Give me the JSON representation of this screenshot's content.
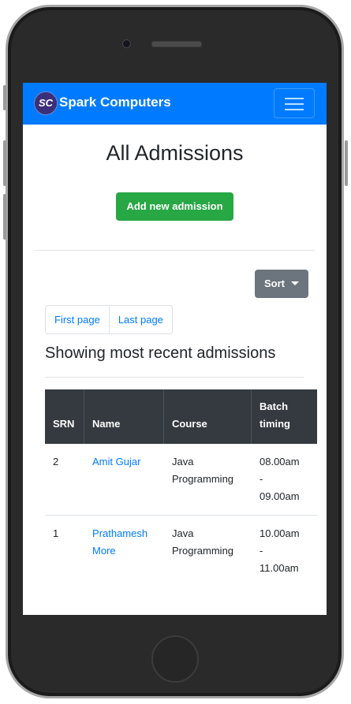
{
  "navbar": {
    "brand_logo_text": "SC",
    "brand_name": "Spark Computers"
  },
  "page": {
    "title": "All Admissions",
    "add_button": "Add new admission",
    "sort_button": "Sort",
    "pagination": {
      "first": "First page",
      "last": "Last page"
    },
    "subtitle": "Showing most recent admissions"
  },
  "table": {
    "headers": {
      "srn": "SRN",
      "name": "Name",
      "course": "Course",
      "batch_line1": "Batch",
      "batch_line2": "timing"
    },
    "rows": [
      {
        "srn": "2",
        "name_line1": "Amit Gujar",
        "name_line2": "",
        "course_line1": "Java",
        "course_line2": "Programming",
        "batch_line1": "08.00am",
        "batch_line2": "-",
        "batch_line3": "09.00am"
      },
      {
        "srn": "1",
        "name_line1": "Prathamesh",
        "name_line2": "More",
        "course_line1": "Java",
        "course_line2": "Programming",
        "batch_line1": "10.00am",
        "batch_line2": "-",
        "batch_line3": "11.00am"
      }
    ]
  },
  "colors": {
    "navbar": "#007bff",
    "success": "#28a745",
    "secondary": "#6c757d",
    "table_header": "#343a40",
    "link": "#007bff"
  },
  "icons": {
    "menu": "hamburger-icon",
    "caret": "caret-down-icon"
  }
}
